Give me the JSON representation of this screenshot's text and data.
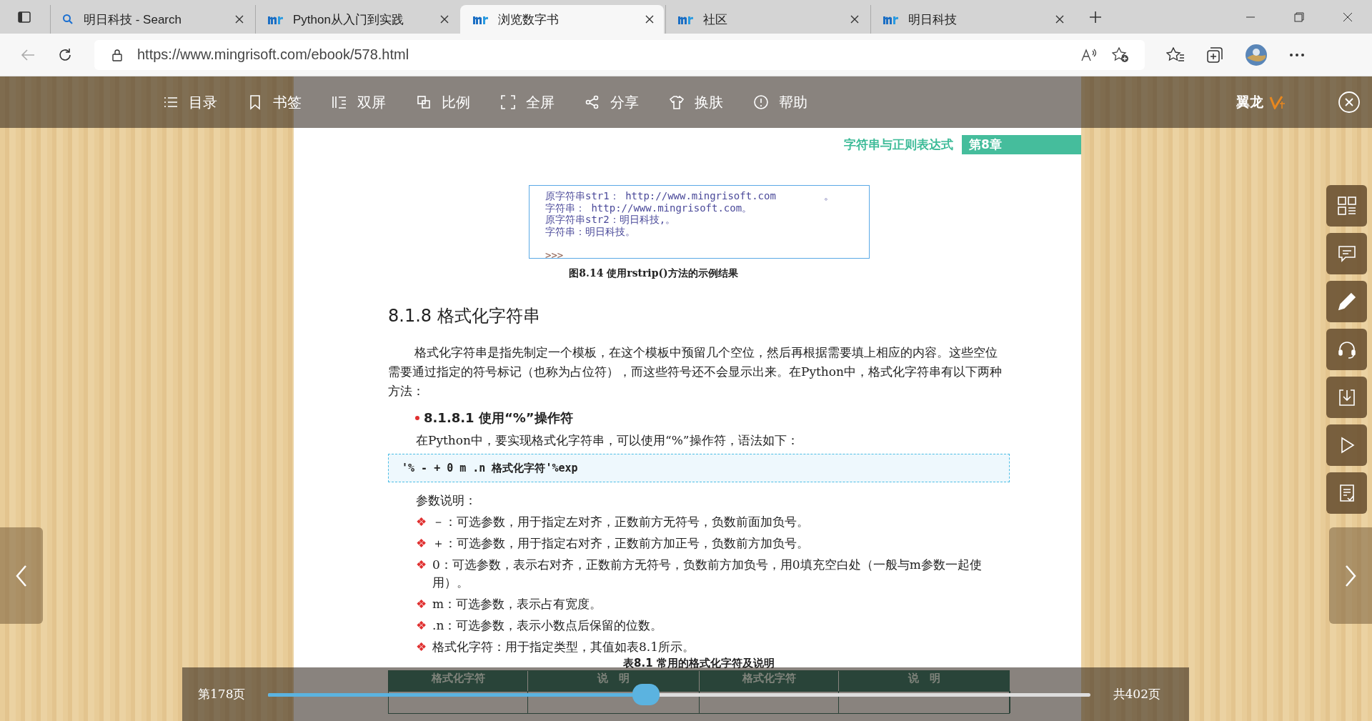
{
  "browser": {
    "tabs": [
      {
        "title": "明日科技 - Search",
        "selected": false
      },
      {
        "title": "Python从入门到实践",
        "selected": false
      },
      {
        "title": "浏览数字书",
        "selected": true
      },
      {
        "title": "社区",
        "selected": false
      },
      {
        "title": "明日科技",
        "selected": false
      }
    ],
    "address": "https://www.mingrisoft.com/ebook/578.html"
  },
  "reader_toolbar": {
    "items": [
      "目录",
      "书签",
      "双屏",
      "比例",
      "全屏",
      "分享",
      "换肤",
      "帮助"
    ],
    "brand": "翼龙"
  },
  "page": {
    "running_head": "字符串与正则表达式",
    "chapter": "第8章",
    "console_lines": [
      "原字符串str1： http://www.mingrisoft.com        。",
      "字符串： http://www.mingrisoft.com。",
      "原字符串str2：明日科技,。",
      "字符串：明日科技。"
    ],
    "prompt": ">>>",
    "figure_caption": "图8.14  使用rstrip()方法的示例结果",
    "section_heading": "8.1.8  格式化字符串",
    "paragraph": "格式化字符串是指先制定一个模板，在这个模板中预留几个空位，然后再根据需要填上相应的内容。这些空位需要通过指定的符号标记（也称为占位符），而这些符号还不会显示出来。在Python中，格式化字符串有以下两种方法：",
    "subsection": "8.1.8.1  使用“%”操作符",
    "intro": "在Python中，要实现格式化字符串，可以使用“%”操作符，语法如下：",
    "syntax": "'% - + 0 m .n 格式化字符'%exp",
    "params_title": "参数说明：",
    "params": [
      {
        "bullet": "❖",
        "text": "－：可选参数，用于指定左对齐，正数前方无符号，负数前面加负号。"
      },
      {
        "bullet": "❖",
        "text": "＋：可选参数，用于指定右对齐，正数前方加正号，负数前方加负号。"
      },
      {
        "bullet": "❖",
        "text": "0：可选参数，表示右对齐，正数前方无符号，负数前方加负号，用0填充空白处（一般与m参数一起使用）。"
      },
      {
        "bullet": "❖",
        "text": "m：可选参数，表示占有宽度。"
      },
      {
        "bullet": "❖",
        "text": ".n：可选参数，表示小数点后保留的位数。"
      },
      {
        "bullet": "❖",
        "text": "格式化字符：用于指定类型，其值如表8.1所示。"
      }
    ],
    "table_caption": "表8.1  常用的格式化字符及说明",
    "table_columns": [
      "格式化字符",
      "说　明",
      "格式化字符",
      "说　明"
    ]
  },
  "pager": {
    "current": "第178页",
    "total": "共402页",
    "level": 0.46
  }
}
